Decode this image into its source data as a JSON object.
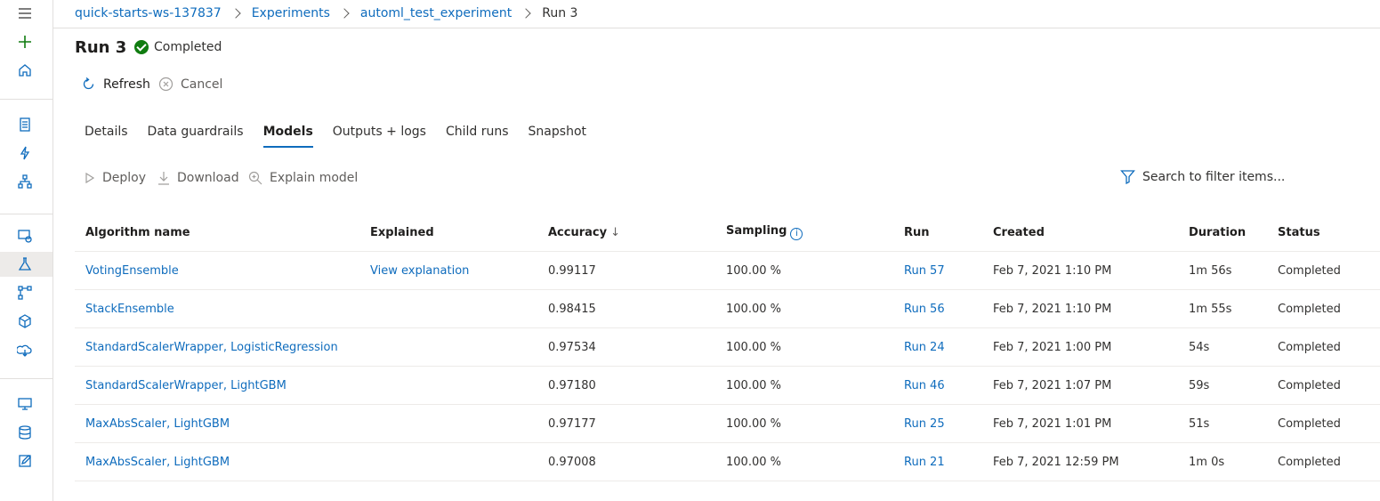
{
  "breadcrumb": [
    "quick-starts-ws-137837",
    "Experiments",
    "automl_test_experiment",
    "Run 3"
  ],
  "title": "Run 3",
  "status": "Completed",
  "commands": {
    "refresh": "Refresh",
    "cancel": "Cancel"
  },
  "tabs": [
    {
      "label": "Details",
      "active": false
    },
    {
      "label": "Data guardrails",
      "active": false
    },
    {
      "label": "Models",
      "active": true
    },
    {
      "label": "Outputs + logs",
      "active": false
    },
    {
      "label": "Child runs",
      "active": false
    },
    {
      "label": "Snapshot",
      "active": false
    }
  ],
  "toolbar": {
    "deploy": "Deploy",
    "download": "Download",
    "explain": "Explain model",
    "search": "Search to filter items..."
  },
  "table": {
    "headers": [
      "Algorithm name",
      "Explained",
      "Accuracy",
      "Sampling",
      "Run",
      "Created",
      "Duration",
      "Status"
    ],
    "rows": [
      {
        "algorithm": "VotingEnsemble",
        "explained": "View explanation",
        "accuracy": "0.99117",
        "sampling": "100.00 %",
        "run": "Run 57",
        "created": "Feb 7, 2021 1:10 PM",
        "duration": "1m 56s",
        "status": "Completed"
      },
      {
        "algorithm": "StackEnsemble",
        "explained": "",
        "accuracy": "0.98415",
        "sampling": "100.00 %",
        "run": "Run 56",
        "created": "Feb 7, 2021 1:10 PM",
        "duration": "1m 55s",
        "status": "Completed"
      },
      {
        "algorithm": "StandardScalerWrapper, LogisticRegression",
        "explained": "",
        "accuracy": "0.97534",
        "sampling": "100.00 %",
        "run": "Run 24",
        "created": "Feb 7, 2021 1:00 PM",
        "duration": "54s",
        "status": "Completed"
      },
      {
        "algorithm": "StandardScalerWrapper, LightGBM",
        "explained": "",
        "accuracy": "0.97180",
        "sampling": "100.00 %",
        "run": "Run 46",
        "created": "Feb 7, 2021 1:07 PM",
        "duration": "59s",
        "status": "Completed"
      },
      {
        "algorithm": "MaxAbsScaler, LightGBM",
        "explained": "",
        "accuracy": "0.97177",
        "sampling": "100.00 %",
        "run": "Run 25",
        "created": "Feb 7, 2021 1:01 PM",
        "duration": "51s",
        "status": "Completed"
      },
      {
        "algorithm": "MaxAbsScaler, LightGBM",
        "explained": "",
        "accuracy": "0.97008",
        "sampling": "100.00 %",
        "run": "Run 21",
        "created": "Feb 7, 2021 12:59 PM",
        "duration": "1m 0s",
        "status": "Completed"
      }
    ]
  }
}
